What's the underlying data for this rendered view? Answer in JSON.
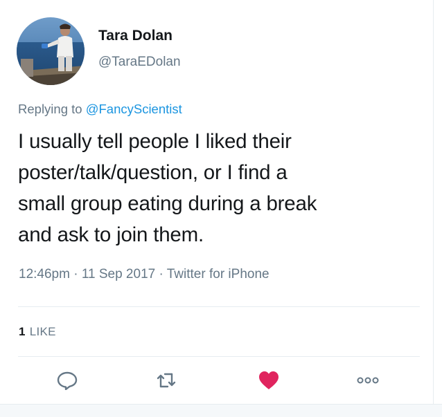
{
  "colors": {
    "text": "#14171a",
    "secondary": "#657786",
    "link": "#1b95e0",
    "like_active": "#e0245e",
    "divider": "#e6ecf0"
  },
  "author": {
    "display_name": "Tara Dolan",
    "handle": "@TaraEDolan"
  },
  "reply": {
    "prefix": "Replying to",
    "mention": "@FancyScientist"
  },
  "tweet": {
    "lines": [
      "I usually tell people I liked their",
      "poster/talk/question, or I find a",
      "small group eating during a break",
      "and ask to join them."
    ],
    "time": "12:46pm",
    "date": "11 Sep 2017",
    "source": "Twitter for iPhone",
    "separator": "·"
  },
  "stats": {
    "likes_count": "1",
    "likes_label": "LIKE"
  },
  "actions": [
    {
      "name": "reply",
      "icon": "speech-bubble-icon"
    },
    {
      "name": "retweet",
      "icon": "retweet-arrows-icon"
    },
    {
      "name": "like",
      "icon": "heart-icon",
      "active": true
    },
    {
      "name": "more",
      "icon": "more-dots-icon"
    }
  ]
}
